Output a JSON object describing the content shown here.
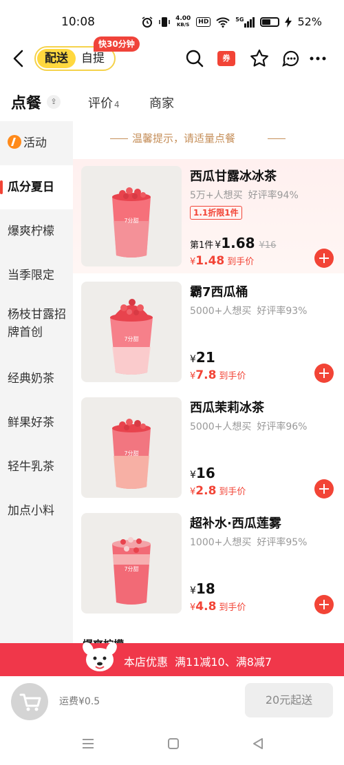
{
  "status": {
    "time": "10:08",
    "net_speed": "4.00",
    "net_unit": "KB/S",
    "hd": "HD",
    "signal": "5G",
    "battery": "52%"
  },
  "header": {
    "mode_active": "配送",
    "mode_other": "自提",
    "fast_badge": "快30分钟",
    "coupon_label": "券"
  },
  "tabs": {
    "main": "点餐",
    "review": "评价",
    "review_count": "4",
    "merchant": "商家"
  },
  "sidebar": {
    "items": [
      {
        "label": "活动"
      },
      {
        "label": "瓜分夏日"
      },
      {
        "label": "爆爽柠檬"
      },
      {
        "label": "当季限定"
      },
      {
        "label": "杨枝甘露招牌首创"
      },
      {
        "label": "经典奶茶"
      },
      {
        "label": "鲜果好茶"
      },
      {
        "label": "轻牛乳茶"
      },
      {
        "label": "加点小料"
      }
    ]
  },
  "tip": "温馨提示，请适量点餐",
  "products": [
    {
      "name": "西瓜甘露冰冰茶",
      "wants": "5万+人想买",
      "rating": "好评率94%",
      "limit": "1.1折限1件",
      "first_label": "第1件",
      "price_symbol": "¥",
      "price": "1.68",
      "old_price": "¥16",
      "final_symbol": "¥",
      "final": "1.48",
      "final_label": "到手价",
      "cup_label": "7分甜"
    },
    {
      "name": "霸7西瓜桶",
      "wants": "5000+人想买",
      "rating": "好评率93%",
      "price_symbol": "¥",
      "price": "21",
      "final_symbol": "¥",
      "final": "7.8",
      "final_label": "到手价",
      "cup_label": "7分甜"
    },
    {
      "name": "西瓜茉莉冰茶",
      "wants": "5000+人想买",
      "rating": "好评率96%",
      "price_symbol": "¥",
      "price": "16",
      "final_symbol": "¥",
      "final": "2.8",
      "final_label": "到手价",
      "cup_label": "7分甜"
    },
    {
      "name": "超补水·西瓜莲雾",
      "wants": "1000+人想买",
      "rating": "好评率95%",
      "price_symbol": "¥",
      "price": "18",
      "final_symbol": "¥",
      "final": "4.8",
      "final_label": "到手价",
      "cup_label": "7分甜"
    }
  ],
  "next_section_peek": "爆爽柠檬",
  "promo": {
    "heading": "本店优惠",
    "text": "满11减10、满8减7"
  },
  "cart": {
    "delivery_fee": "运费¥0.5",
    "min_order": "20元起送"
  },
  "colors": {
    "accent": "#f24436",
    "brand_yellow": "#ffd83f",
    "tip": "#c58e58",
    "promo_bg": "#f0374a"
  }
}
